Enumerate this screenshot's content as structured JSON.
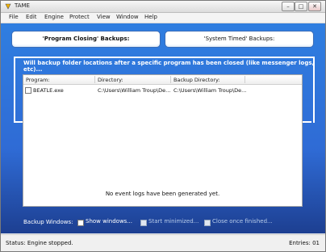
{
  "window": {
    "title": "TAME"
  },
  "menu": [
    "File",
    "Edit",
    "Engine",
    "Protect",
    "View",
    "Window",
    "Help"
  ],
  "tabs": {
    "program_closing": "'Program Closing' Backups:",
    "system_timed": "'System Timed' Backups:"
  },
  "panel": {
    "description": "Will backup folder locations after a specific program has been closed (like messenger logs, etc)..."
  },
  "list": {
    "columns": [
      "Program:",
      "Directory:",
      "Backup Directory:"
    ],
    "rows": [
      {
        "checked": false,
        "program": "BEATLE.exe",
        "directory": "C:\\Users\\William Troup\\De...",
        "backup": "C:\\Users\\William Troup\\De..."
      }
    ],
    "empty_message": "No event logs have been generated yet."
  },
  "backup_windows": {
    "label": "Backup Windows:",
    "show": {
      "label": "Show windows...",
      "checked": false
    },
    "minimized": {
      "label": "Start minimized...",
      "checked": true
    },
    "close": {
      "label": "Close once finished...",
      "checked": true
    }
  },
  "status": {
    "text": "Status: Engine stopped.",
    "entries": "Entries: 01"
  }
}
